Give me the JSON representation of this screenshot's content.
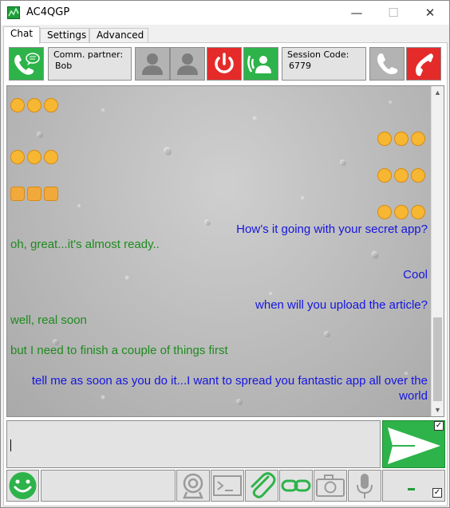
{
  "window": {
    "title": "AC4QGP",
    "minimize": "—",
    "maximize": "☐",
    "close": "✕"
  },
  "tabs": [
    {
      "label": "Chat",
      "active": true
    },
    {
      "label": "Settings",
      "active": false
    },
    {
      "label": "Advanced",
      "active": false
    }
  ],
  "toolbar": {
    "partner_label": "Comm. partner:",
    "partner_value": "Bob",
    "session_label": "Session Code:",
    "session_value": "6779",
    "icons": [
      "chat-call-icon",
      "user-icon",
      "user-icon",
      "power-icon",
      "voice-call-icon",
      "phone-icon",
      "hangup-icon"
    ]
  },
  "chat": {
    "messages": [
      {
        "side": "left",
        "type": "emoji",
        "emoji": [
          "kiss",
          "kiss",
          "kiss"
        ]
      },
      {
        "side": "right",
        "type": "emoji",
        "emoji": [
          "heart-eyes",
          "heart-eyes",
          "heart-eyes"
        ]
      },
      {
        "side": "left",
        "type": "emoji",
        "emoji": [
          "heart-eyes",
          "heart-eyes",
          "heart-eyes"
        ]
      },
      {
        "side": "right",
        "type": "emoji",
        "emoji": [
          "blush",
          "blush",
          "blush"
        ]
      },
      {
        "side": "left",
        "type": "emoji",
        "emoji": [
          "raised-hands",
          "raised-hands",
          "raised-hands"
        ]
      },
      {
        "side": "right",
        "type": "emoji",
        "emoji": [
          "sunglasses",
          "sunglasses",
          "sunglasses"
        ]
      },
      {
        "side": "right",
        "type": "text",
        "text": "How’s it going with your secret app?"
      },
      {
        "side": "left",
        "type": "text",
        "text": "oh, great...it's almost ready.."
      },
      {
        "side": "right",
        "type": "text",
        "text": "Cool"
      },
      {
        "side": "right",
        "type": "text",
        "text": "when will you upload the article?"
      },
      {
        "side": "left",
        "type": "text",
        "text": "well, real soon"
      },
      {
        "side": "left",
        "type": "text",
        "text": "but I need to finish a couple of things first"
      },
      {
        "side": "right",
        "type": "text",
        "text": "tell me as soon as you do it...I want to spread you fantastic app all over the world"
      }
    ]
  },
  "input": {
    "value": ""
  },
  "send": {
    "checked": true,
    "check_mark": "✓"
  },
  "bottom": {
    "icons": [
      "smiley-icon",
      "webcam-icon",
      "terminal-icon",
      "paperclip-icon",
      "link-icon",
      "camera-icon",
      "microphone-icon"
    ],
    "level_checked": true,
    "check_mark": "✓"
  },
  "colors": {
    "green": "#2db34a",
    "red": "#e52a2a",
    "partner_text": "#1e8a1e",
    "own_text": "#1515e0"
  }
}
